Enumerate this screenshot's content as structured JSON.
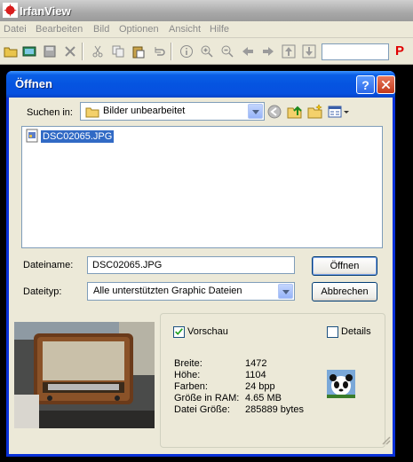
{
  "app": {
    "title": "IrfanView",
    "menu": [
      "Datei",
      "Bearbeiten",
      "Bild",
      "Optionen",
      "Ansicht",
      "Hilfe"
    ],
    "toolbar_p": "P",
    "toolbar_input_value": ""
  },
  "dialog": {
    "title": "Öffnen",
    "help_label": "?",
    "look_in_label": "Suchen in:",
    "look_in_value": "Bilder unbearbeitet",
    "files": [
      {
        "name": "DSC02065.JPG",
        "selected": true
      }
    ],
    "filename_label": "Dateiname:",
    "filename_value": "DSC02065.JPG",
    "filetype_label": "Dateityp:",
    "filetype_value": "Alle unterstützten Graphic Dateien",
    "open_button": "Öffnen",
    "cancel_button": "Abbrechen",
    "preview_label": "Vorschau",
    "preview_checked": true,
    "details_label": "Details",
    "details_checked": false,
    "info": [
      {
        "key": "Breite:",
        "value": "1472"
      },
      {
        "key": "Höhe:",
        "value": "1104"
      },
      {
        "key": "Farben:",
        "value": "24 bpp"
      },
      {
        "key": "Größe in RAM:",
        "value": "4.65 MB"
      },
      {
        "key": "Datei Größe:",
        "value": "285889 bytes"
      }
    ]
  },
  "colors": {
    "accent": "#0554e0",
    "selection": "#316ac5",
    "dialog_bg": "#ece9d8",
    "brand_red": "#e00000"
  }
}
